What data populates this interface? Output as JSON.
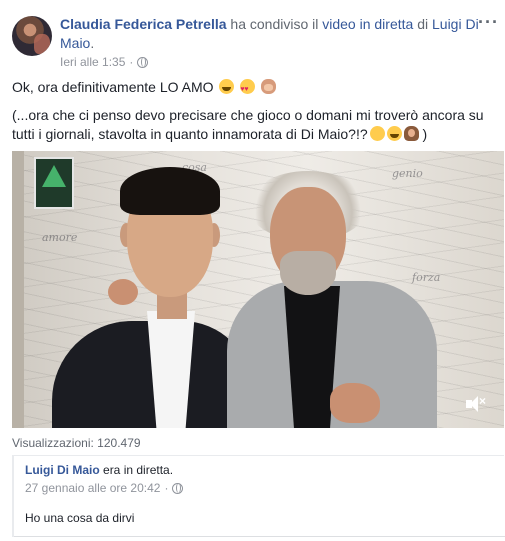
{
  "post": {
    "author": "Claudia Federica Petrella",
    "action": "ha condiviso il",
    "object_link": "video in diretta",
    "preposition": "di",
    "target": "Luigi Di Maio",
    "period": ".",
    "timestamp": "Ieri alle 1:35",
    "privacy_icon": "globe-icon",
    "more_icon": "···",
    "text_line1": "Ok, ora definitivamente LO AMO",
    "text_line2": "(...ora che ci penso devo precisare che gioco o domani mi troverò ancora su tutti i giornali, stavolta in quanto innamorata di Di Maio?!?",
    "text_line2_end": ")"
  },
  "video": {
    "mute_icon": "speaker-muted-icon",
    "mute_symbol": "×",
    "views_label": "Visualizzazioni:",
    "views_count": "120.479"
  },
  "shared": {
    "name": "Luigi Di Maio",
    "status": "era in diretta.",
    "date": "27 gennaio alle ore 20:42",
    "message": "Ho una cosa da dirvi"
  },
  "colors": {
    "link": "#365899",
    "muted": "#90949c",
    "text": "#1d2129"
  }
}
